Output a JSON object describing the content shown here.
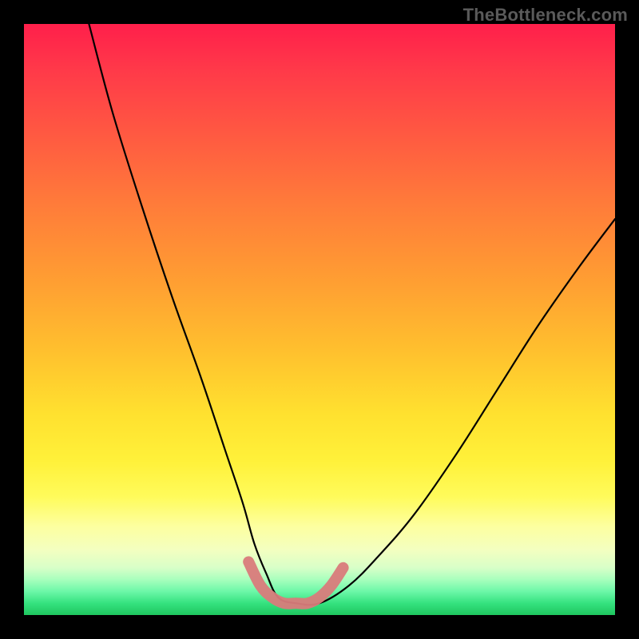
{
  "watermark": "TheBottleneck.com",
  "chart_data": {
    "type": "line",
    "title": "",
    "xlabel": "",
    "ylabel": "",
    "xlim": [
      0,
      100
    ],
    "ylim": [
      0,
      100
    ],
    "grid": false,
    "series": [
      {
        "name": "black-curve",
        "color": "#000000",
        "x": [
          11,
          15,
          20,
          25,
          30,
          34,
          37,
          39,
          41,
          43,
          46,
          50,
          55,
          60,
          66,
          73,
          80,
          87,
          94,
          100
        ],
        "values": [
          100,
          85,
          69,
          54,
          40,
          28,
          19,
          12,
          7,
          3,
          2,
          2,
          5,
          10,
          17,
          27,
          38,
          49,
          59,
          67
        ]
      },
      {
        "name": "pink-band",
        "color": "#d97b7b",
        "x": [
          38,
          40,
          42,
          44,
          46,
          48,
          50,
          52,
          54
        ],
        "values": [
          9,
          5,
          3,
          2,
          2,
          2,
          3,
          5,
          8
        ]
      }
    ],
    "annotations": [
      {
        "text": "TheBottleneck.com",
        "position": "top-right"
      }
    ]
  },
  "colors": {
    "gradient_top": "#ff1f4b",
    "gradient_mid": "#ffe12f",
    "gradient_bottom": "#1fc65f",
    "black": "#000000",
    "pink_band": "#d97b7b",
    "watermark": "#5a5a5a"
  }
}
